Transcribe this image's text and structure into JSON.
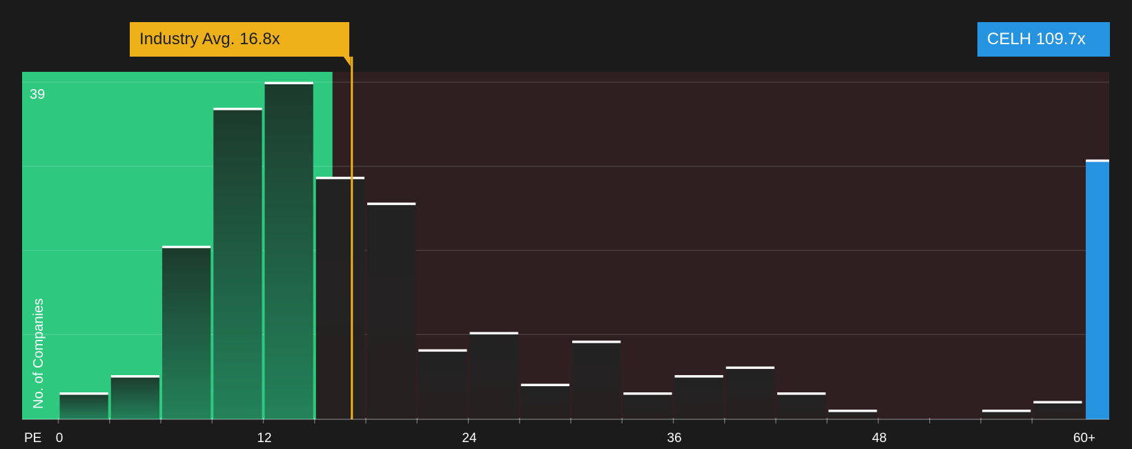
{
  "chart_data": {
    "type": "bar",
    "xlabel": "PE",
    "ylabel": "No. of Companies",
    "y_max_label": "39",
    "ylim": [
      0,
      40
    ],
    "x_tick_labels": [
      "0",
      "12",
      "24",
      "36",
      "48",
      "60+"
    ],
    "x_tick_values": [
      0,
      12,
      24,
      36,
      48,
      60
    ],
    "bin_width": 3,
    "x_range": [
      -2.1,
      61.5
    ],
    "bins": [
      {
        "start": 0,
        "value": 3
      },
      {
        "start": 3,
        "value": 5
      },
      {
        "start": 6,
        "value": 20
      },
      {
        "start": 9,
        "value": 36
      },
      {
        "start": 12,
        "value": 39
      },
      {
        "start": 15,
        "value": 28
      },
      {
        "start": 18,
        "value": 25
      },
      {
        "start": 21,
        "value": 8
      },
      {
        "start": 24,
        "value": 10
      },
      {
        "start": 27,
        "value": 4
      },
      {
        "start": 30,
        "value": 9
      },
      {
        "start": 33,
        "value": 3
      },
      {
        "start": 36,
        "value": 5
      },
      {
        "start": 39,
        "value": 6
      },
      {
        "start": 42,
        "value": 3
      },
      {
        "start": 45,
        "value": 1
      },
      {
        "start": 48,
        "value": 0
      },
      {
        "start": 51,
        "value": 0
      },
      {
        "start": 54,
        "value": 1
      },
      {
        "start": 57,
        "value": 2
      }
    ],
    "company_bar": {
      "label": "CELH",
      "pe": 109.7,
      "value": 30
    },
    "industry_avg": 16.8,
    "fair_region_end": 16.8
  },
  "industry_badge": {
    "label": "Industry Avg.",
    "value": "16.8x"
  },
  "company_badge": {
    "ticker": "CELH",
    "value": "109.7x"
  },
  "colors": {
    "background": "#1b1b1b",
    "green_region": "#2ec87f",
    "red_region": "#2f1f20",
    "industry": "#eeb11a",
    "company": "#2593e0"
  }
}
